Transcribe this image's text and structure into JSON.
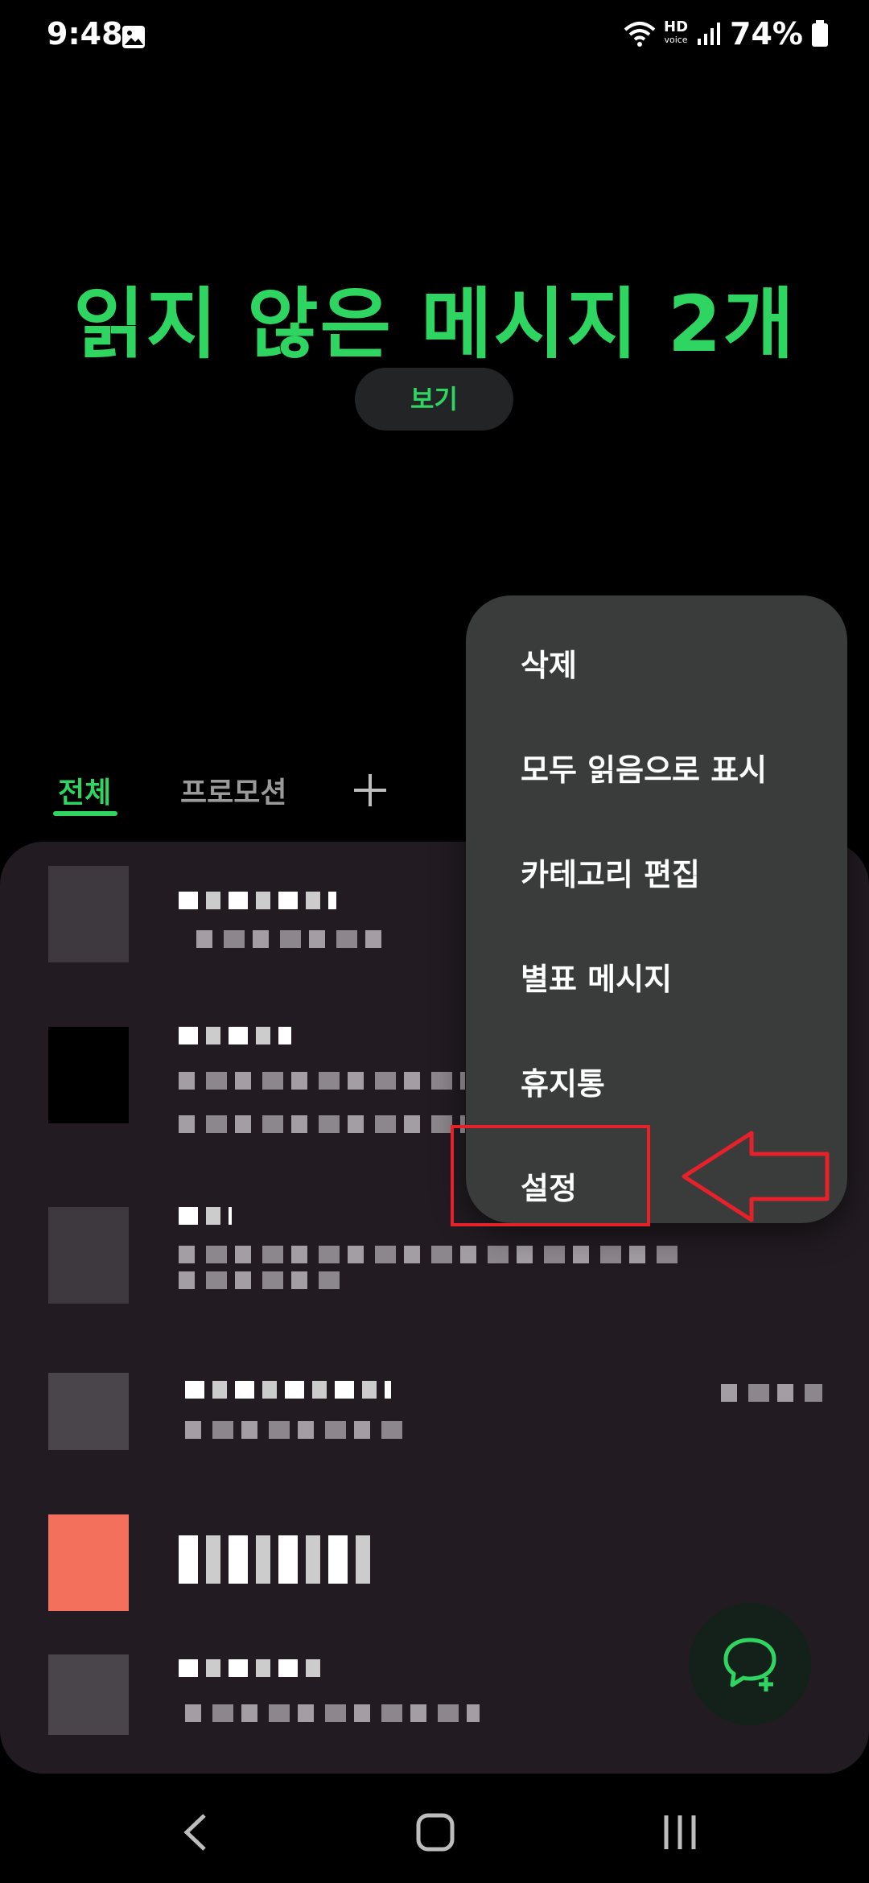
{
  "status_bar": {
    "time": "9:48",
    "hd_label": "HD",
    "voice_label": "voice",
    "battery": "74%",
    "icons": [
      "gallery-icon",
      "wifi-icon",
      "signal-icon",
      "battery-icon"
    ]
  },
  "header": {
    "title": "읽지 않은 메시지 2개",
    "view_button": "보기"
  },
  "tabs": {
    "all": "전체",
    "promotion": "프로모션",
    "add_icon": "plus-icon"
  },
  "menu": {
    "items": [
      "삭제",
      "모두 읽음으로 표시",
      "카테고리 편집",
      "별표 메시지",
      "휴지통",
      "설정"
    ]
  },
  "colors": {
    "accent": "#2fd561",
    "menu_bg": "#3a3b3b",
    "list_bg": "#221c22",
    "highlight": "#e5212a"
  },
  "fab": {
    "icon": "new-chat-icon"
  },
  "nav": {
    "icons": [
      "back-icon",
      "home-icon",
      "recents-icon"
    ]
  }
}
